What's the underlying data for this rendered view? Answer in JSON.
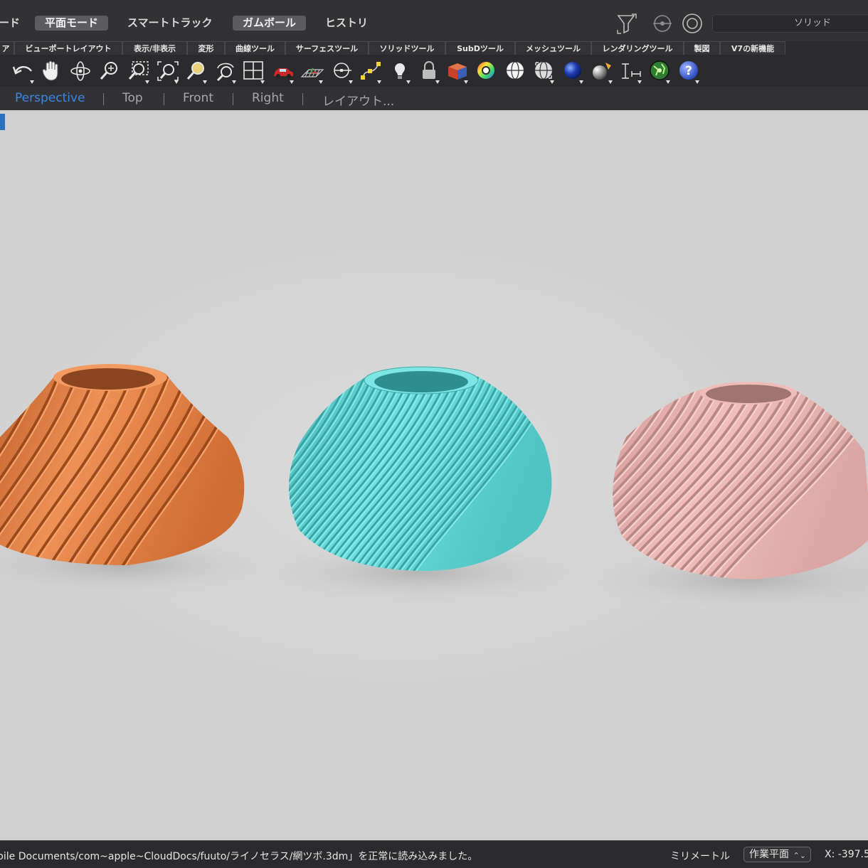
{
  "modebar": {
    "modes": [
      {
        "label": "ード",
        "active": false
      },
      {
        "label": "平面モード",
        "active": true
      },
      {
        "label": "スマートトラック",
        "active": false
      },
      {
        "label": "ガムボール",
        "active": true
      },
      {
        "label": "ヒストリ",
        "active": false
      }
    ],
    "display_mode": "ソリッド"
  },
  "tabs": [
    "ア",
    "ビューポートレイアウト",
    "表示/非表示",
    "変形",
    "曲線ツール",
    "サーフェスツール",
    "ソリッドツール",
    "SubDツール",
    "メッシュツール",
    "レンダリングツール",
    "製図",
    "V7の新機能"
  ],
  "toolbar": {
    "tools": [
      "undo-icon",
      "pan-hand-icon",
      "rotate-view-icon",
      "zoom-icon",
      "zoom-window-icon",
      "zoom-extents-icon",
      "zoom-selected-icon",
      "rotate-camera-icon",
      "four-viewports-icon",
      "car-object-icon",
      "grid-plane-icon",
      "object-snap-icon",
      "points-on-icon",
      "light-bulb-icon",
      "lock-icon",
      "box-solid-icon",
      "color-wheel-icon",
      "wireframe-sphere-icon",
      "shaded-sphere-icon",
      "rendered-sphere-icon",
      "render-light-icon",
      "dimension-icon",
      "globe-icon",
      "help-icon"
    ]
  },
  "viewports": {
    "tabs": [
      "Perspective",
      "Top",
      "Front",
      "Right",
      "レイアウト..."
    ],
    "active": "Perspective"
  },
  "scene": {
    "objects": [
      {
        "name": "orange-vase",
        "color": "#e8874a"
      },
      {
        "name": "cyan-vase",
        "color": "#5fd2d0"
      },
      {
        "name": "pink-vase",
        "color": "#e8b3b0"
      }
    ],
    "background": "#d4d4d4"
  },
  "statusbar": {
    "message": "bile Documents/com~apple~CloudDocs/fuuto/ライノセラス/網ツボ.3dm」を正常に読み込みました。",
    "units": "ミリメートル",
    "plane": "作業平面",
    "coords": "X: -397.5"
  }
}
